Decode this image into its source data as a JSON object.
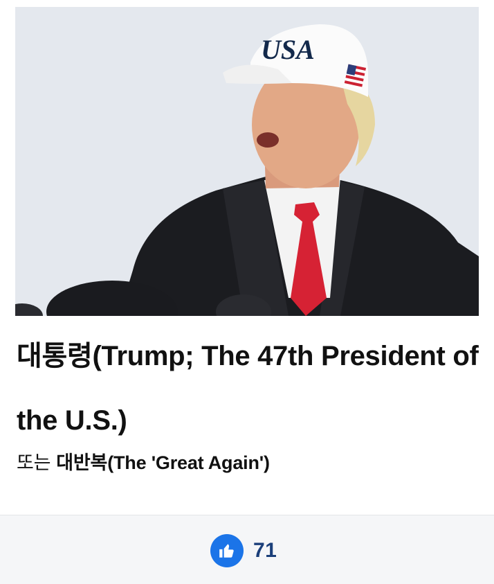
{
  "article": {
    "photo_alt": "portrait-photo",
    "cap_text": "USA",
    "headline": "대통령(Trump; The 47th President of the U.S.)",
    "subline_lead": "또는",
    "subline_strong": "대반복(The 'Great Again')"
  },
  "reactions": {
    "like_icon": "thumbs-up-icon",
    "like_count": "71"
  },
  "colors": {
    "accent": "#1b74e8",
    "count": "#1b3f7a",
    "footer_bg": "#f5f6f8"
  }
}
